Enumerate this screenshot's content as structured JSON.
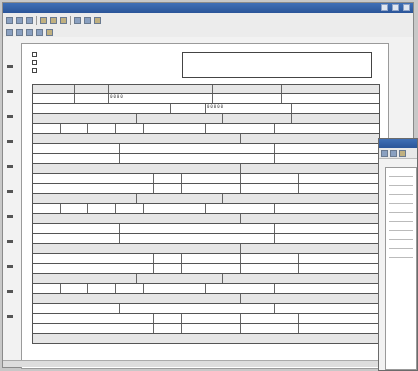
{
  "window": {
    "title": "",
    "colors": {
      "titlebar": "#2b5599",
      "page": "#ffffff",
      "chrome": "#f2f2f2"
    }
  },
  "toolbar": {
    "icons": [
      "open-icon",
      "save-icon",
      "print-icon",
      "cut-icon",
      "copy-icon",
      "paste-icon",
      "undo-icon",
      "zoom-icon",
      "help-icon"
    ]
  },
  "form": {
    "checkbox_options": [
      "",
      "",
      ""
    ],
    "big_values": [
      "0000",
      "00000"
    ],
    "sections": 8
  },
  "second_window": {
    "title": ""
  }
}
